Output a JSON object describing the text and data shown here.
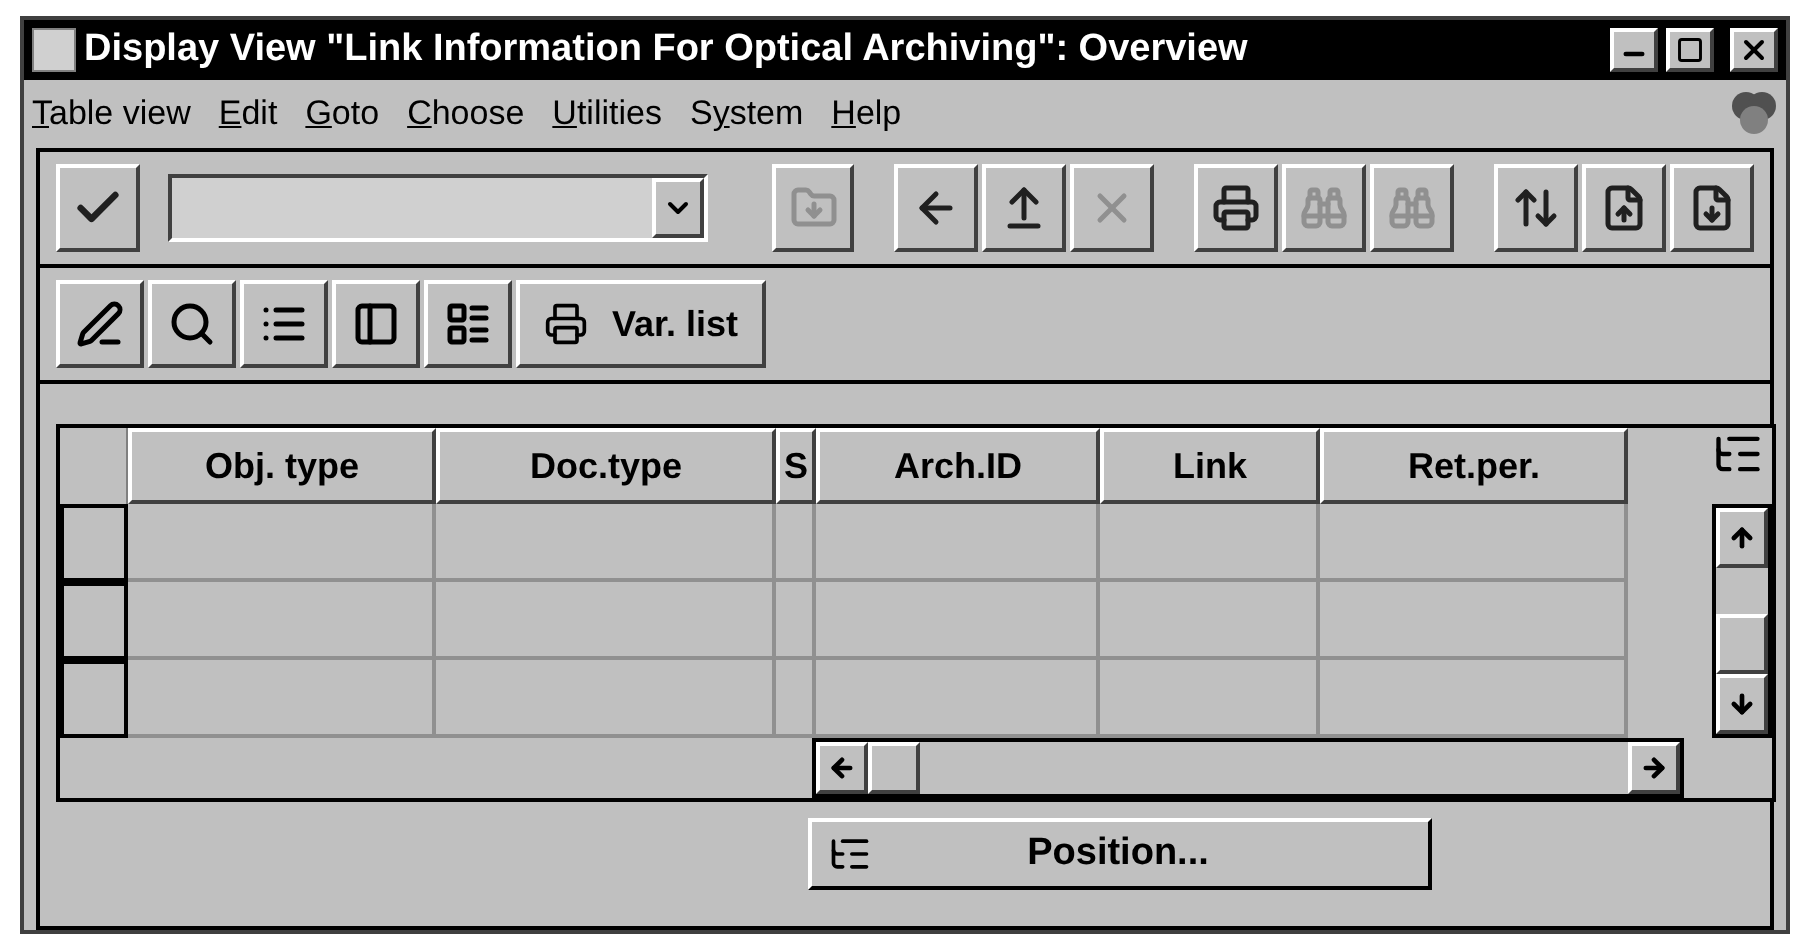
{
  "window": {
    "title": "Display View \"Link Information For Optical Archiving\": Overview"
  },
  "menu": [
    {
      "key": "T",
      "after": "able view"
    },
    {
      "key": "E",
      "after": "dit"
    },
    {
      "key": "G",
      "after": "oto"
    },
    {
      "key": "C",
      "after": "hoose"
    },
    {
      "key": "U",
      "after": "tilities"
    },
    {
      "before": "S",
      "key": "y",
      "after": "stem"
    },
    {
      "key": "H",
      "after": "elp"
    }
  ],
  "toolbar": {
    "buttons": [
      {
        "disabled": false
      },
      {
        "disabled": true
      },
      {
        "disabled": false
      },
      {
        "disabled": false
      },
      {
        "disabled": true
      },
      {
        "disabled": false
      },
      {
        "disabled": true
      },
      {
        "disabled": true
      },
      {
        "disabled": false
      },
      {
        "disabled": false
      },
      {
        "disabled": false
      }
    ]
  },
  "app_toolbar": {
    "buttons": [
      {
        "kind": "icon"
      },
      {
        "kind": "icon"
      },
      {
        "kind": "icon"
      },
      {
        "kind": "icon"
      },
      {
        "kind": "icon"
      },
      {
        "kind": "text",
        "label": "Var. list"
      }
    ]
  },
  "table": {
    "columns": [
      "Obj. type",
      "Doc.type",
      "S",
      "Arch.ID",
      "Link",
      "Ret.per."
    ],
    "rows": [
      {
        "selected": false
      },
      {
        "selected": false
      },
      {
        "selected": false
      }
    ]
  },
  "position_button": {
    "label": "Position..."
  }
}
